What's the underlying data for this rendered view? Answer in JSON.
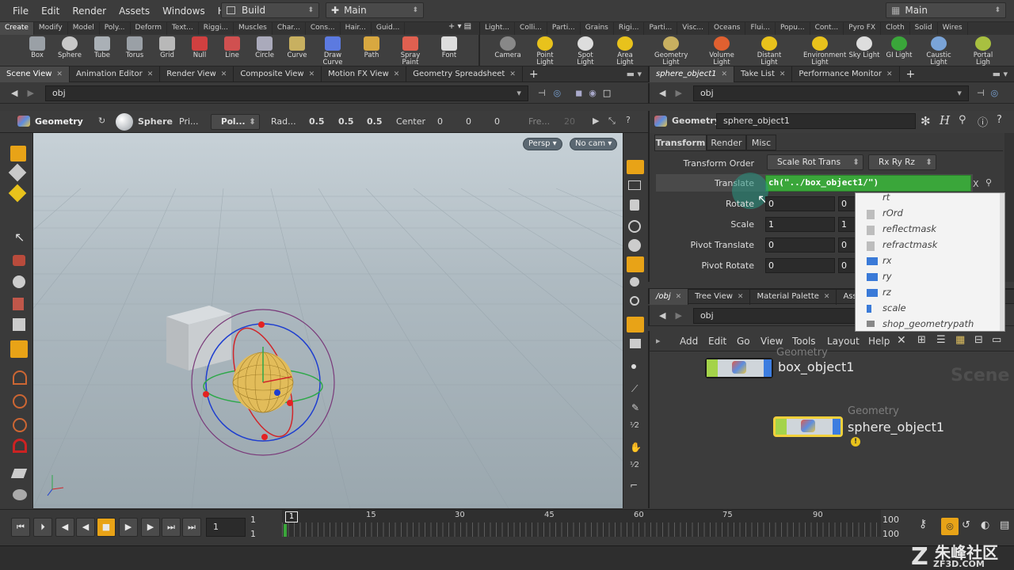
{
  "menu": {
    "items": [
      "File",
      "Edit",
      "Render",
      "Assets",
      "Windows",
      "Help"
    ],
    "desktop": "Build",
    "desktop2": "Main",
    "right_desktop": "Main"
  },
  "shelf": {
    "left_tabs": [
      "Create",
      "Modify",
      "Model",
      "Poly...",
      "Deform",
      "Text...",
      "Riggi...",
      "Muscles",
      "Char...",
      "Cons...",
      "Hair...",
      "Guid..."
    ],
    "right_tabs": [
      "Light...",
      "Colli...",
      "Parti...",
      "Grains",
      "Rigi...",
      "Parti...",
      "Visc...",
      "Oceans",
      "Flui...",
      "Popu...",
      "Cont...",
      "Pyro FX",
      "Cloth",
      "Solid",
      "Wires"
    ],
    "left_tools": [
      "Box",
      "Sphere",
      "Tube",
      "Torus",
      "Grid",
      "Null",
      "Line",
      "Circle",
      "Curve",
      "Draw Curve",
      "Path",
      "Spray Paint",
      "Font"
    ],
    "right_tools": [
      "Camera",
      "Point Light",
      "Spot Light",
      "Area Light",
      "Geometry Light",
      "Volume Light",
      "Distant Light",
      "Environment Light",
      "Sky Light",
      "GI Light",
      "Caustic Light",
      "Portal Ligh"
    ]
  },
  "left_pane": {
    "tabs": [
      "Scene View",
      "Animation Editor",
      "Render View",
      "Composite View",
      "Motion FX View",
      "Geometry Spreadsheet"
    ],
    "path": "obj",
    "op_context": "Geometry",
    "sphere_label": "Sphere",
    "prim_label": "Pri...",
    "prim_type": "Pol...",
    "radius_label": "Rad...",
    "radius": [
      "0.5",
      "0.5",
      "0.5"
    ],
    "center_label": "Center",
    "center": [
      "0",
      "0",
      "0"
    ],
    "freq_label": "Fre...",
    "freq_value": "20",
    "persp": "Persp",
    "camera": "No cam"
  },
  "right_pane": {
    "tabs": [
      "sphere_object1",
      "Take List",
      "Performance Monitor"
    ],
    "path": "obj",
    "node_type": "Geometry",
    "node_name": "sphere_object1",
    "param_tabs": [
      "Transform",
      "Render",
      "Misc"
    ],
    "transform_order_label": "Transform Order",
    "transform_order": "Scale Rot Trans",
    "rotate_order": "Rx Ry Rz",
    "translate_label": "Translate",
    "translate_expr": "ch(\"../box_object1/\")",
    "translate_x_mark": "X",
    "rotate_label": "Rotate",
    "rotate": [
      "0",
      "0"
    ],
    "scale_label": "Scale",
    "scale": [
      "1",
      "1"
    ],
    "pivot_translate_label": "Pivot Translate",
    "pivot_translate": [
      "0",
      "0"
    ],
    "pivot_rotate_label": "Pivot Rotate",
    "pivot_rotate": [
      "0",
      "0"
    ]
  },
  "autocomplete": {
    "items": [
      "rt",
      "rOrd",
      "reflectmask",
      "refractmask",
      "rx",
      "ry",
      "rz",
      "scale",
      "shop_geometrypath"
    ]
  },
  "network": {
    "tabs": [
      "/obj",
      "Tree View",
      "Material Palette",
      "Asse"
    ],
    "path": "obj",
    "menu": [
      "Add",
      "Edit",
      "Go",
      "View",
      "Tools",
      "Layout",
      "Help"
    ],
    "watermark": "Scene",
    "nodes": [
      {
        "type": "Geometry",
        "name": "box_object1"
      },
      {
        "type": "Geometry",
        "name": "sphere_object1"
      }
    ]
  },
  "timeline": {
    "frame": "1",
    "start": "1",
    "start2": "1",
    "ticks": [
      "1",
      "15",
      "30",
      "45",
      "60",
      "75",
      "90"
    ],
    "end": "100",
    "end2": "100"
  },
  "watermark_text": {
    "cn": "朱峰社区",
    "url": "ZF3D.COM"
  },
  "colors": {
    "accent_orange": "#e8a317",
    "expr_green": "#3aa63a",
    "node_selected": "#f2d03b"
  }
}
